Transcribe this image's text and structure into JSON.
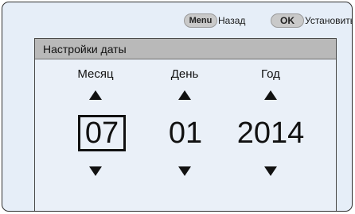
{
  "hints": {
    "menu_key": "Menu",
    "menu_label": "Назад",
    "ok_key": "OK",
    "ok_label": "Установить"
  },
  "panel": {
    "title": "Настройки даты",
    "columns": [
      {
        "label": "Месяц",
        "value": "07",
        "selected": true
      },
      {
        "label": "День",
        "value": "01",
        "selected": false
      },
      {
        "label": "Год",
        "value": "2014",
        "selected": false
      }
    ]
  }
}
